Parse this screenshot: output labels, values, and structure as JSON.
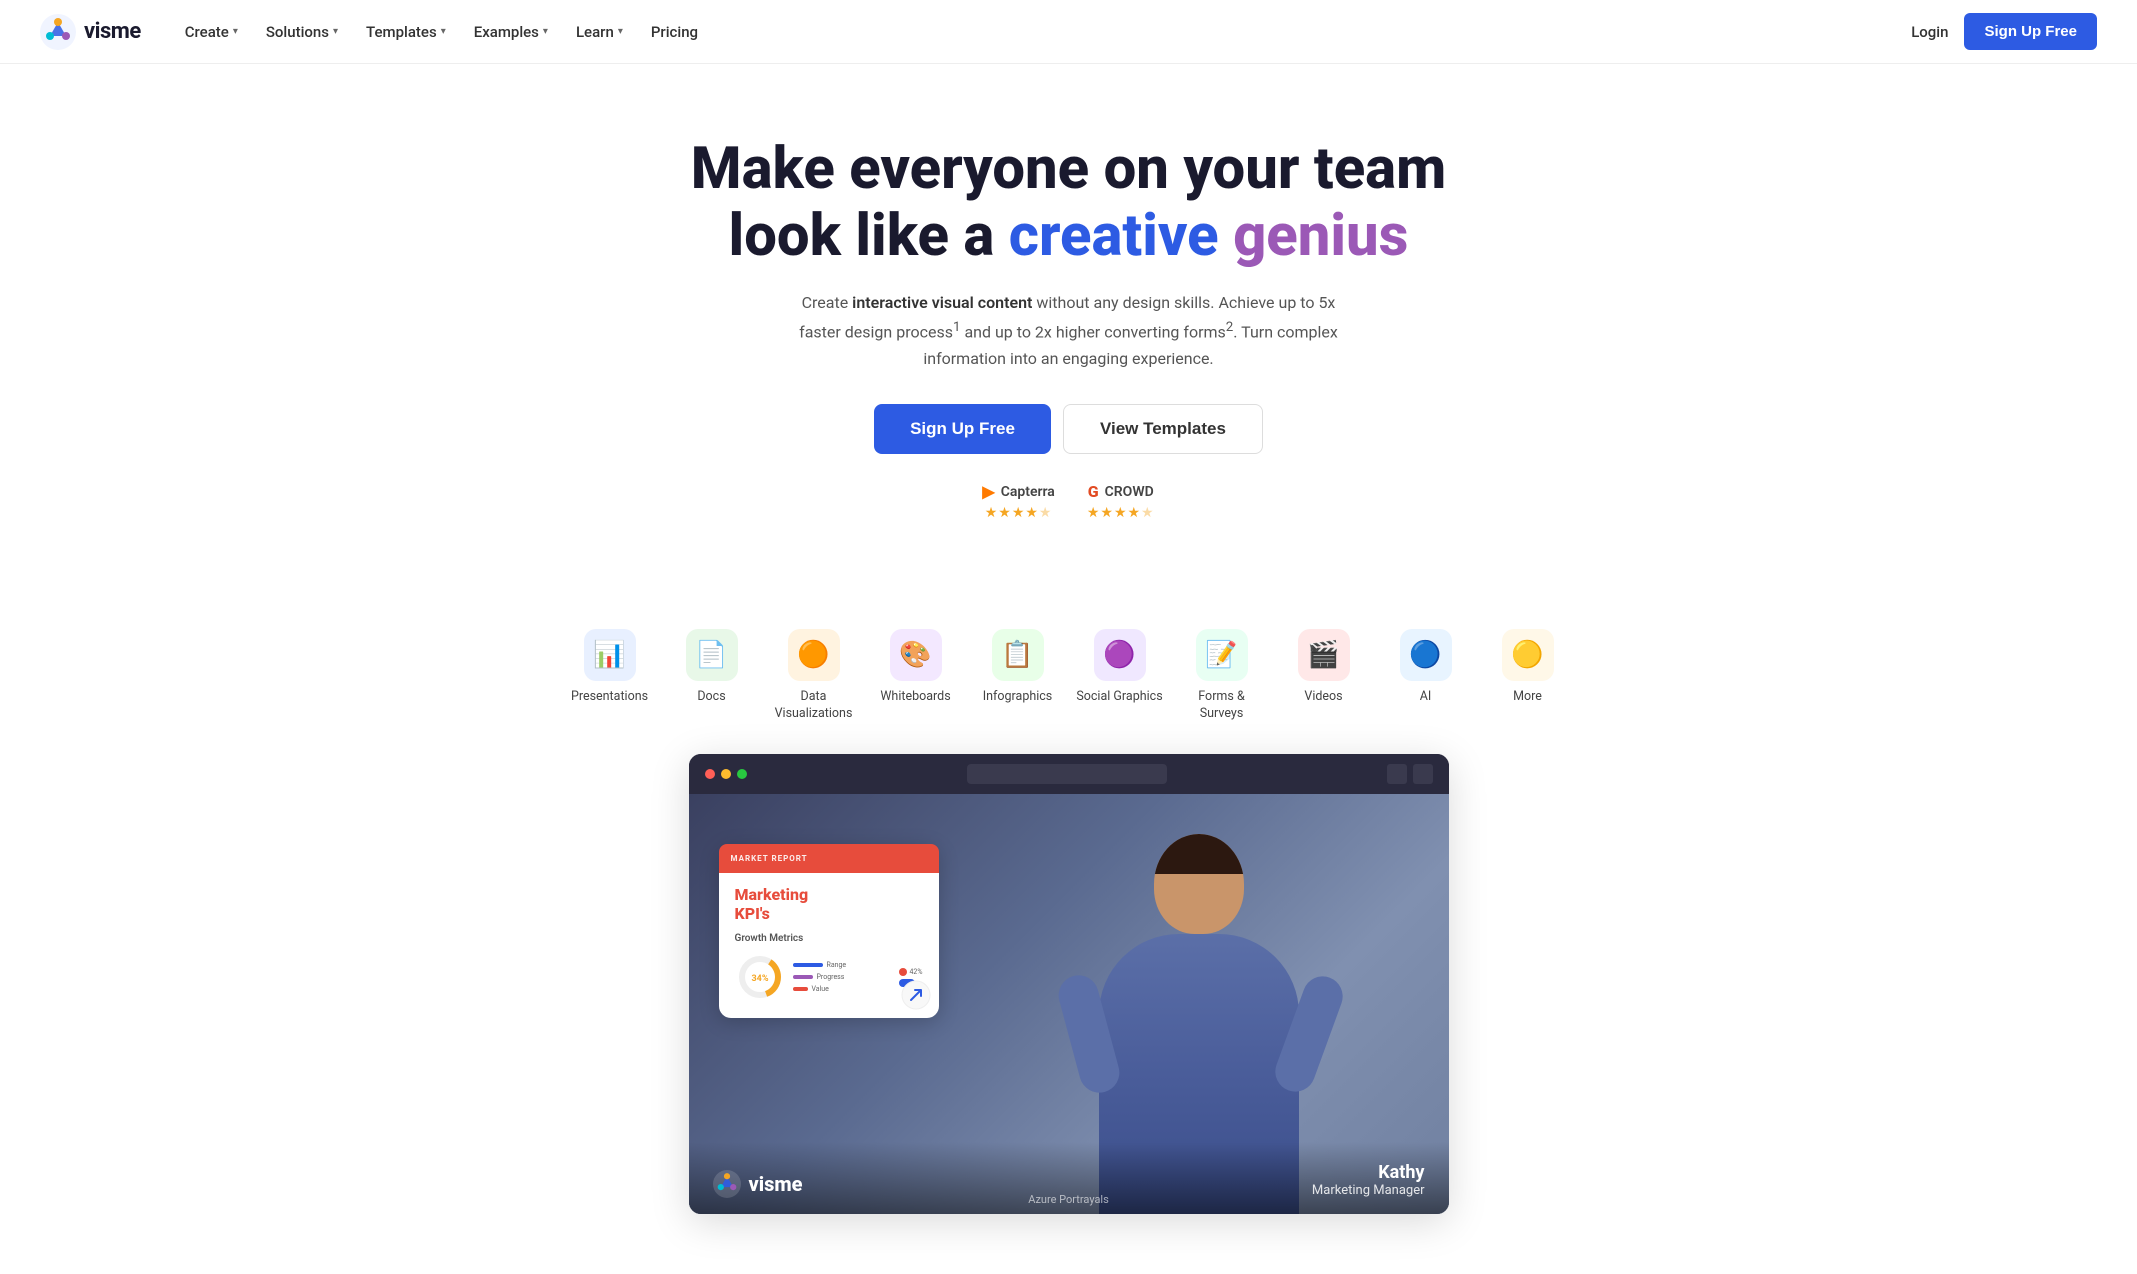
{
  "nav": {
    "logo_text": "visme",
    "items": [
      {
        "label": "Create",
        "has_dropdown": true
      },
      {
        "label": "Solutions",
        "has_dropdown": true
      },
      {
        "label": "Templates",
        "has_dropdown": true
      },
      {
        "label": "Examples",
        "has_dropdown": true
      },
      {
        "label": "Learn",
        "has_dropdown": true
      },
      {
        "label": "Pricing",
        "has_dropdown": false
      }
    ],
    "login_label": "Login",
    "signup_label": "Sign Up Free"
  },
  "hero": {
    "title_line1": "Make everyone on your team",
    "title_line2_start": "look like a ",
    "title_creative": "creative",
    "title_genius": "genius",
    "subtitle_part1": "Create ",
    "subtitle_bold": "interactive visual content",
    "subtitle_part2": " without any design skills. Achieve up to 5x faster design process",
    "subtitle_sup": "1",
    "subtitle_part3": " and up to 2x higher converting forms",
    "subtitle_sup2": "2",
    "subtitle_part4": ". Turn complex information into an engaging experience.",
    "btn_signup": "Sign Up Free",
    "btn_templates": "View Templates"
  },
  "ratings": [
    {
      "brand": "Capterra",
      "icon": "▶",
      "stars": "★★★★★",
      "half": false
    },
    {
      "brand": "CROWD",
      "icon": "G",
      "stars": "★★★★★",
      "half": false
    }
  ],
  "categories": [
    {
      "label": "Presentations",
      "icon": "📊",
      "bg": "#e8f0ff"
    },
    {
      "label": "Docs",
      "icon": "📄",
      "bg": "#e8f8e8"
    },
    {
      "label": "Data Visualizations",
      "icon": "🟠",
      "bg": "#fff3e0"
    },
    {
      "label": "Whiteboards",
      "icon": "🎨",
      "bg": "#f3e8ff"
    },
    {
      "label": "Infographics",
      "icon": "📋",
      "bg": "#e8ffe8"
    },
    {
      "label": "Social Graphics",
      "icon": "🟣",
      "bg": "#f0e8ff"
    },
    {
      "label": "Forms & Surveys",
      "icon": "📝",
      "bg": "#e8fff3"
    },
    {
      "label": "Videos",
      "icon": "🎬",
      "bg": "#ffe8e8"
    },
    {
      "label": "AI",
      "icon": "🔵",
      "bg": "#e8f4ff"
    },
    {
      "label": "More",
      "icon": "🟡",
      "bg": "#fff8e8"
    }
  ],
  "video": {
    "person_name": "Kathy",
    "person_title": "Marketing Manager",
    "logo_text": "visme",
    "attribution": "Azure Portrayals",
    "card": {
      "header": "MARKET REPORT",
      "title": "Marketing\nKPI's",
      "metric_label": "Growth Metrics",
      "percentage": "34%"
    }
  }
}
